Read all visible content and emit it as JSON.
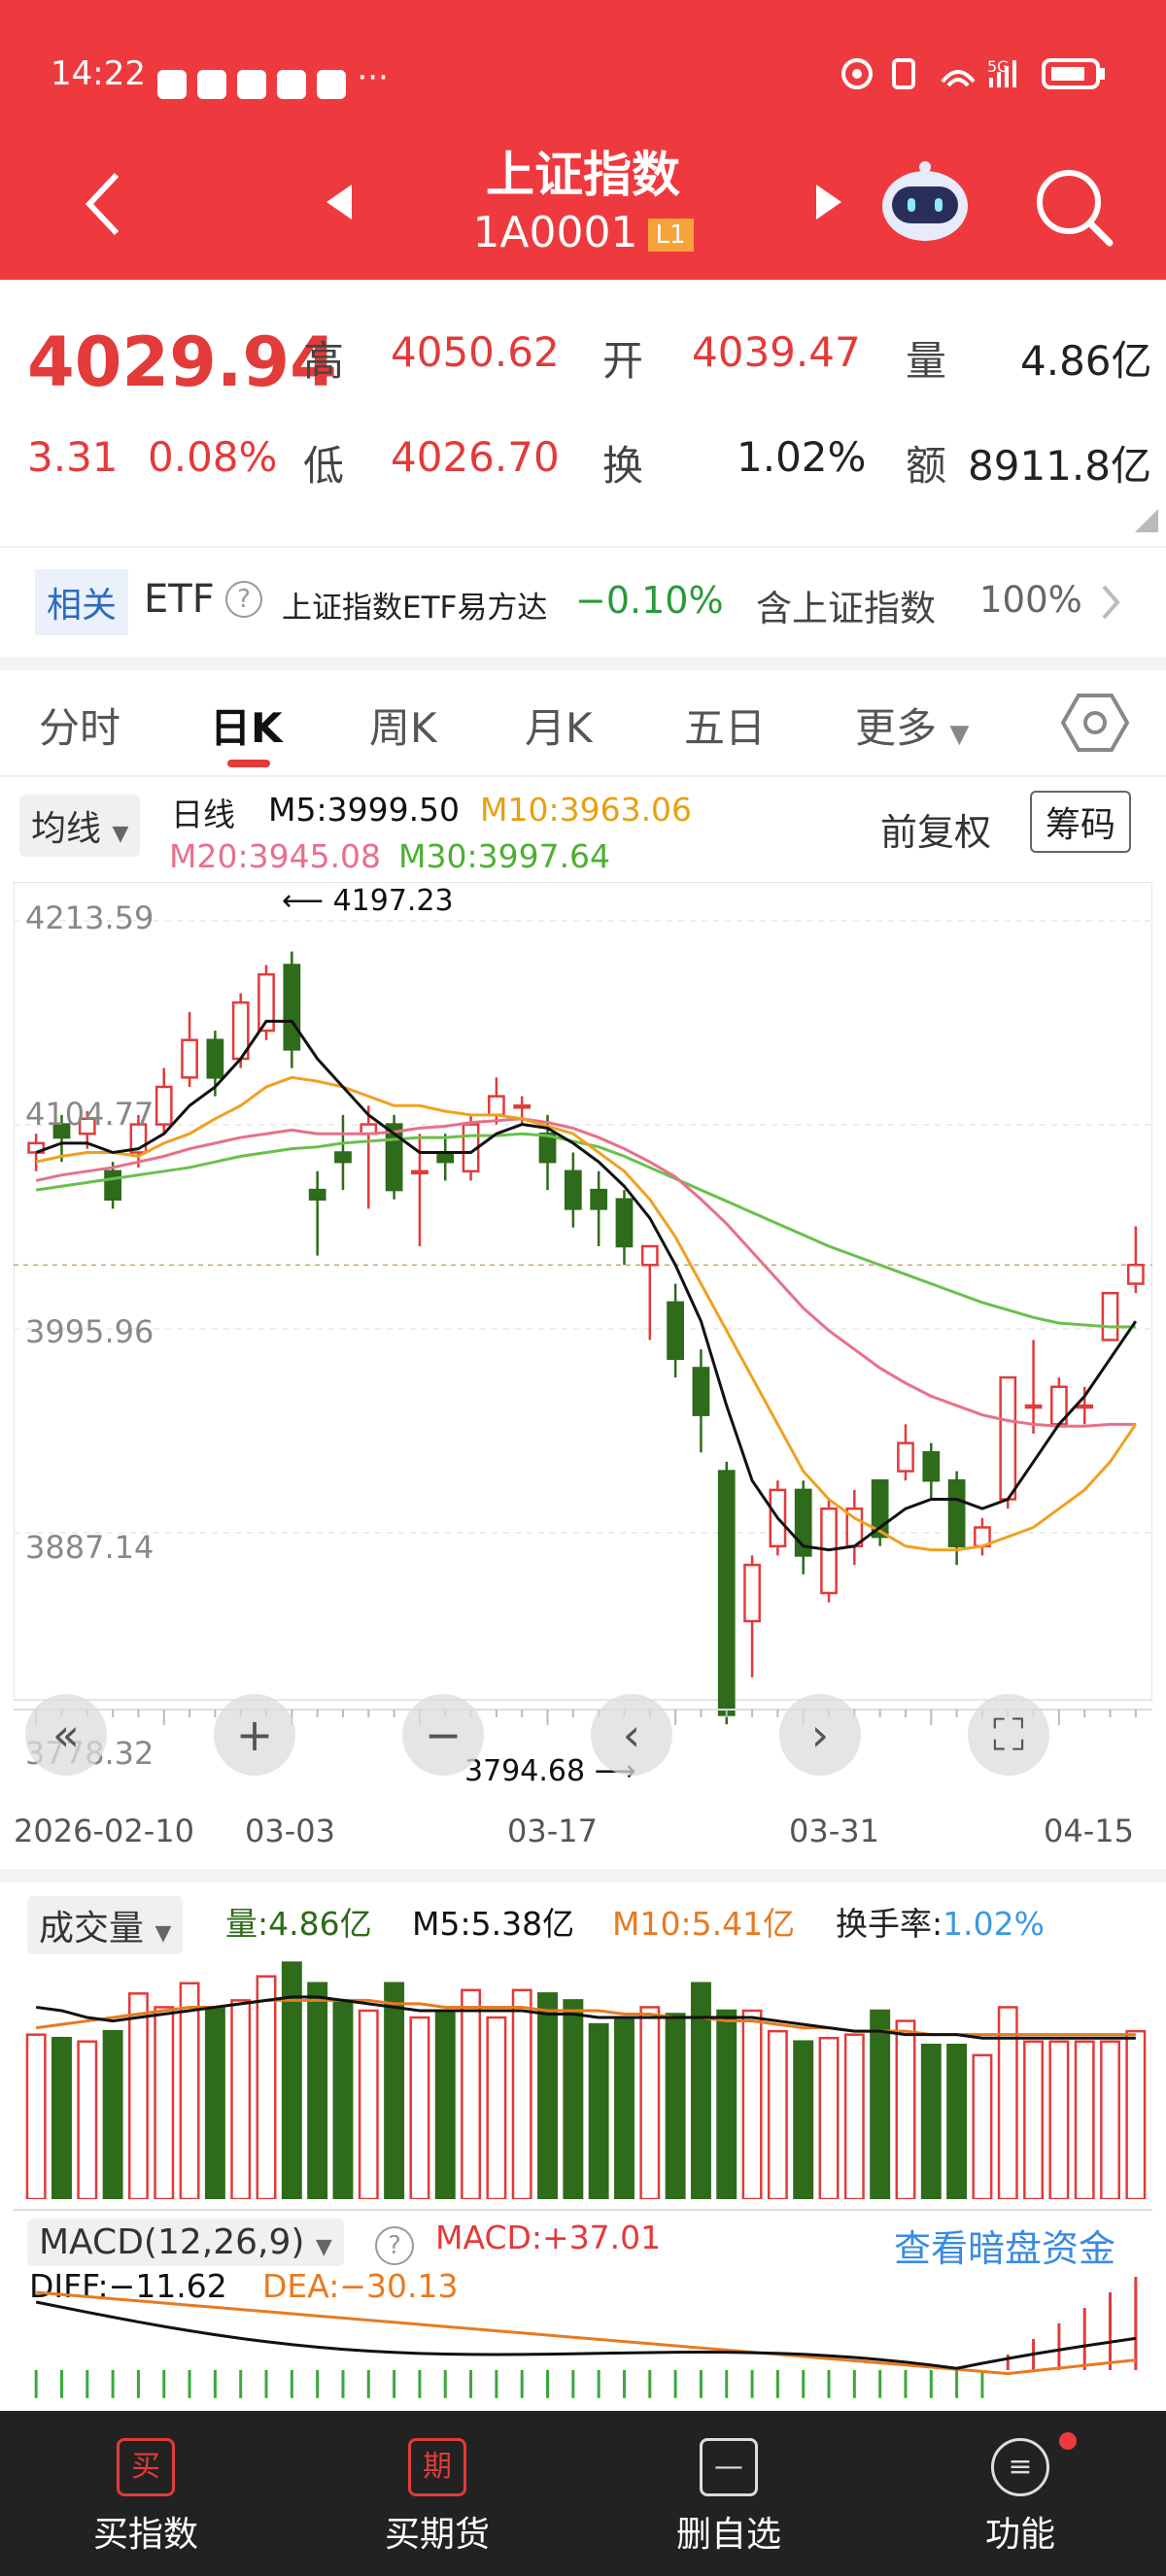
{
  "status_bar": {
    "time": "14:22",
    "dots": "···",
    "net": "5G"
  },
  "header": {
    "title": "上证指数",
    "code": "1A0001",
    "level": "L1",
    "back": "‹",
    "prev": "◀",
    "next": "▶"
  },
  "quote": {
    "price": "4029.94",
    "change": "3.31",
    "change_pct": "0.08%",
    "high_label": "高",
    "high": "4050.62",
    "open_label": "开",
    "open": "4039.47",
    "vol_label": "量",
    "vol": "4.86亿",
    "low_label": "低",
    "low": "4026.70",
    "turn_label": "换",
    "turn": "1.02%",
    "amt_label": "额",
    "amt": "8911.8亿"
  },
  "etf": {
    "tag": "相关",
    "label": "ETF",
    "q": "?",
    "name": "上证指数ETF易方达",
    "pct": "−0.10%",
    "hold_label": "含上证指数",
    "hold": "100%"
  },
  "tabs": [
    "分时",
    "日K",
    "周K",
    "月K",
    "五日",
    "更多"
  ],
  "chart_header": {
    "ma_btn": "均线",
    "period": "日线",
    "m5": "M5:3999.50",
    "m10": "M10:3963.06",
    "m20": "M20:3945.08",
    "m30": "M30:3997.64",
    "adj": "前复权",
    "chip": "筹码"
  },
  "chart_data": [
    {
      "type": "candlestick",
      "ylim": [
        3778.32,
        4213.59
      ],
      "y_ticks": [
        "4213.59",
        "4104.77",
        "3995.96",
        "3887.14",
        "3778.32"
      ],
      "x_ticks": [
        "2026-02-10",
        "03-03",
        "03-17",
        "03-31",
        "04-15"
      ],
      "annotations": {
        "high": "4197.23",
        "low": "3794.68"
      },
      "candles": [
        [
          4090,
          4095,
          4080,
          4100
        ],
        [
          4105,
          4098,
          4085,
          4110
        ],
        [
          4100,
          4108,
          4092,
          4112
        ],
        [
          4080,
          4065,
          4060,
          4085
        ],
        [
          4090,
          4105,
          4082,
          4110
        ],
        [
          4105,
          4125,
          4100,
          4135
        ],
        [
          4130,
          4150,
          4125,
          4165
        ],
        [
          4150,
          4130,
          4120,
          4155
        ],
        [
          4140,
          4170,
          4135,
          4175
        ],
        [
          4155,
          4185,
          4150,
          4190
        ],
        [
          4190,
          4145,
          4135,
          4197.23
        ],
        [
          4070,
          4065,
          4035,
          4080
        ],
        [
          4090,
          4085,
          4070,
          4110
        ],
        [
          4100,
          4105,
          4060,
          4115
        ],
        [
          4105,
          4070,
          4065,
          4110
        ],
        [
          4080,
          4080,
          4040,
          4100
        ],
        [
          4090,
          4085,
          4075,
          4100
        ],
        [
          4080,
          4105,
          4075,
          4110
        ],
        [
          4110,
          4120,
          4105,
          4130
        ],
        [
          4115,
          4115,
          4105,
          4120
        ],
        [
          4100,
          4085,
          4070,
          4110
        ],
        [
          4080,
          4060,
          4050,
          4090
        ],
        [
          4070,
          4060,
          4040,
          4080
        ],
        [
          4065,
          4040,
          4030,
          4070
        ],
        [
          4030,
          4040,
          3990,
          4040
        ],
        [
          4010,
          3980,
          3970,
          4020
        ],
        [
          3975,
          3950,
          3930,
          3985
        ],
        [
          3920,
          3790,
          3785,
          3925
        ],
        [
          3840,
          3870,
          3810,
          3875
        ],
        [
          3880,
          3910,
          3875,
          3915
        ],
        [
          3910,
          3875,
          3865,
          3915
        ],
        [
          3855,
          3900,
          3850,
          3905
        ],
        [
          3880,
          3900,
          3870,
          3910
        ],
        [
          3915,
          3885,
          3880,
          3915
        ],
        [
          3920,
          3935,
          3915,
          3945
        ],
        [
          3930,
          3915,
          3905,
          3935
        ],
        [
          3915,
          3880,
          3870,
          3920
        ],
        [
          3880,
          3890,
          3875,
          3895
        ],
        [
          3905,
          3970,
          3900,
          3970
        ],
        [
          3955,
          3955,
          3940,
          3990
        ],
        [
          3945,
          3965,
          3945,
          3970
        ],
        [
          3955,
          3955,
          3945,
          3965
        ],
        [
          3990,
          4015,
          3990,
          4015
        ],
        [
          4020,
          4030,
          4015,
          4050.62
        ]
      ],
      "ma5": [
        4090,
        4095,
        4095,
        4090,
        4092,
        4100,
        4115,
        4125,
        4140,
        4160,
        4160,
        4140,
        4125,
        4110,
        4100,
        4090,
        4090,
        4090,
        4100,
        4105,
        4103,
        4095,
        4085,
        4072,
        4055,
        4030,
        4000,
        3955,
        3915,
        3895,
        3880,
        3878,
        3880,
        3890,
        3900,
        3905,
        3905,
        3900,
        3905,
        3925,
        3945,
        3960,
        3980,
        4000
      ],
      "ma10": [
        4085,
        4088,
        4090,
        4090,
        4088,
        4095,
        4100,
        4108,
        4115,
        4125,
        4130,
        4128,
        4125,
        4120,
        4115,
        4115,
        4112,
        4110,
        4110,
        4108,
        4104,
        4100,
        4090,
        4080,
        4065,
        4045,
        4020,
        3995,
        3970,
        3945,
        3920,
        3905,
        3895,
        3888,
        3880,
        3878,
        3878,
        3880,
        3885,
        3890,
        3900,
        3910,
        3925,
        3945
      ],
      "ma20": [
        4075,
        4078,
        4080,
        4082,
        4085,
        4088,
        4092,
        4095,
        4098,
        4100,
        4102,
        4100,
        4100,
        4100,
        4101,
        4103,
        4104,
        4106,
        4107,
        4108,
        4106,
        4103,
        4098,
        4092,
        4085,
        4077,
        4065,
        4052,
        4037,
        4022,
        4007,
        3995,
        3985,
        3975,
        3967,
        3960,
        3955,
        3950,
        3947,
        3945,
        3944,
        3944,
        3945,
        3945
      ],
      "ma30": [
        4070,
        4072,
        4074,
        4076,
        4078,
        4080,
        4082,
        4085,
        4088,
        4090,
        4092,
        4093,
        4095,
        4096,
        4097,
        4098,
        4098,
        4099,
        4099,
        4100,
        4099,
        4096,
        4093,
        4088,
        4082,
        4076,
        4070,
        4064,
        4058,
        4052,
        4046,
        4040,
        4035,
        4030,
        4025,
        4020,
        4015,
        4010,
        4006,
        4002,
        3999,
        3998,
        3997,
        3997
      ]
    },
    {
      "type": "bar",
      "title": "成交量",
      "labels": {
        "vol": "量:4.86亿",
        "m5": "M5:5.38亿",
        "m10": "M10:5.41亿",
        "turn_label": "换手率:",
        "turn": "1.02%"
      },
      "values": [
        4.8,
        4.7,
        4.6,
        4.9,
        6.0,
        5.6,
        6.3,
        5.6,
        5.8,
        6.5,
        6.9,
        6.3,
        5.8,
        5.5,
        6.3,
        5.3,
        5.5,
        6.1,
        5.3,
        6.1,
        6.0,
        5.8,
        5.1,
        5.3,
        5.6,
        5.4,
        6.3,
        5.5,
        5.5,
        4.9,
        4.6,
        4.7,
        4.8,
        5.5,
        5.2,
        4.5,
        4.5,
        4.2,
        5.6,
        4.6,
        4.6,
        4.6,
        4.6,
        4.9
      ],
      "ma5": [
        5.6,
        5.5,
        5.3,
        5.2,
        5.3,
        5.4,
        5.5,
        5.6,
        5.7,
        5.8,
        5.9,
        5.9,
        5.8,
        5.7,
        5.6,
        5.5,
        5.5,
        5.5,
        5.5,
        5.5,
        5.4,
        5.4,
        5.3,
        5.3,
        5.3,
        5.3,
        5.3,
        5.3,
        5.3,
        5.2,
        5.1,
        5.0,
        4.9,
        4.9,
        4.8,
        4.8,
        4.8,
        4.7,
        4.7,
        4.7,
        4.7,
        4.7,
        4.7,
        4.7
      ],
      "ma10": [
        5.0,
        5.1,
        5.2,
        5.3,
        5.4,
        5.5,
        5.6,
        5.6,
        5.7,
        5.8,
        5.8,
        5.8,
        5.8,
        5.8,
        5.7,
        5.7,
        5.6,
        5.6,
        5.6,
        5.6,
        5.5,
        5.5,
        5.5,
        5.4,
        5.4,
        5.3,
        5.3,
        5.2,
        5.2,
        5.1,
        5.0,
        5.0,
        4.9,
        4.9,
        4.9,
        4.8,
        4.8,
        4.8,
        4.8,
        4.8,
        4.8,
        4.8,
        4.8,
        4.8
      ]
    },
    {
      "type": "bar",
      "title": "MACD(12,26,9)",
      "labels": {
        "macd": "MACD:+37.01",
        "diff": "DIFF:−11.62",
        "dea": "DEA:−30.13",
        "link": "查看暗盘资金"
      },
      "hist": [
        -3,
        -3,
        -3,
        -3,
        -3,
        -3,
        -3,
        -3,
        -3,
        -3,
        -3,
        -3,
        -3,
        -3,
        -3,
        -3,
        -3,
        -3,
        -3,
        -3,
        -3,
        -3,
        -3,
        -3,
        -3,
        -3,
        -3,
        -3,
        -3,
        -3,
        -3,
        -3,
        -3,
        -3,
        -3,
        -3,
        -3,
        -3,
        5,
        10,
        15,
        20,
        25,
        30
      ]
    }
  ],
  "chart_nav": {
    "rewind": "«",
    "zoom_in": "+",
    "zoom_out": "−",
    "prev": "‹",
    "next": "›",
    "full": "⛶"
  },
  "bottom_bar": [
    {
      "icon": "买",
      "label": "买指数"
    },
    {
      "icon": "期",
      "label": "买期货"
    },
    {
      "icon": "—",
      "label": "删自选"
    },
    {
      "icon": "≡",
      "label": "功能"
    }
  ],
  "colors": {
    "header": "#ee3a3f",
    "up": "#e33a3a",
    "down": "#2e6b1a",
    "ma5": "#111111",
    "ma10": "#f0a020",
    "ma20": "#e8708a",
    "ma30": "#6ac04a"
  }
}
